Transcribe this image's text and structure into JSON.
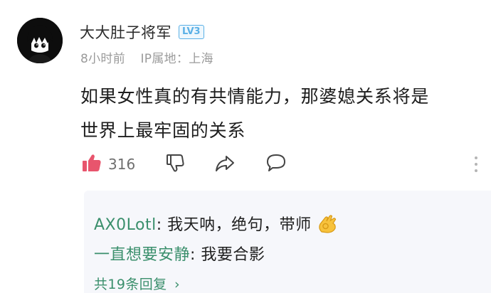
{
  "comment": {
    "username": "大大肚子将军",
    "level": "LV3",
    "time": "8小时前",
    "ip_location": "IP属地：上海",
    "text_line1": "如果女性真的有共情能力，那婆媳关系将是",
    "text_line2": "世界上最牢固的关系",
    "likes": "316",
    "icons": {
      "like": "thumb-up-icon",
      "dislike": "thumb-down-icon",
      "share": "share-icon",
      "reply": "comment-icon",
      "more": "more-vertical-icon"
    }
  },
  "replies": [
    {
      "user": "AX0Lotl",
      "separator": ": ",
      "text": "我天呐，绝句，带师",
      "emoji": "ok-hand-emoji"
    },
    {
      "user": "一直想要安静",
      "separator": ": ",
      "text": "我要合影"
    }
  ],
  "more_replies": {
    "label": "共19条回复",
    "arrow": "›"
  },
  "colors": {
    "like_icon": "#e8556d",
    "level_badge": "#5ab0e6",
    "reply_user": "#3a8f6c",
    "reply_bg": "#f6f7fb"
  }
}
